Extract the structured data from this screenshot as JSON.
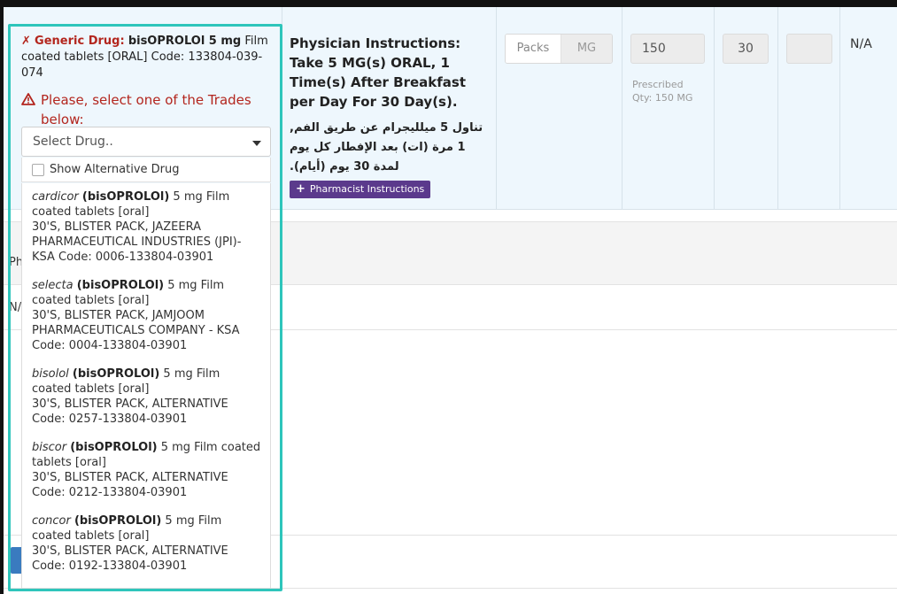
{
  "generic": {
    "x_mark": "✗",
    "label": "Generic Drug:",
    "name": "bisOPROLOl 5 mg",
    "rest": " Film coated tablets [ORAL] Code: 133804-039-074"
  },
  "warning": {
    "text": "Please, select one of the Trades below:",
    "icon": "warning-triangle-icon",
    "color": "#b3261e"
  },
  "select": {
    "placeholder": "Select Drug.."
  },
  "show_alternative": {
    "label": "Show Alternative Drug",
    "checked": false
  },
  "options": [
    {
      "trade": "cardicor",
      "generic": "(bisOPROLOl)",
      "form": " 5 mg Film coated tablets [oral]",
      "details": "30'S, BLISTER PACK, JAZEERA PHARMACEUTICAL INDUSTRIES (JPI)- KSA Code: 0006-133804-03901"
    },
    {
      "trade": "selecta",
      "generic": "(bisOPROLOl)",
      "form": " 5 mg Film coated tablets [oral]",
      "details": "30'S, BLISTER PACK, JAMJOOM PHARMACEUTICALS COMPANY - KSA Code: 0004-133804-03901"
    },
    {
      "trade": "bisolol",
      "generic": "(bisOPROLOl)",
      "form": " 5 mg Film coated tablets [oral]",
      "details": "30'S, BLISTER PACK, ALTERNATIVE Code: 0257-133804-03901"
    },
    {
      "trade": "biscor",
      "generic": "(bisOPROLOl)",
      "form": " 5 mg Film coated tablets [oral]",
      "details": "30'S, BLISTER PACK, ALTERNATIVE Code: 0212-133804-03901"
    },
    {
      "trade": "concor",
      "generic": "(bisOPROLOl)",
      "form": " 5 mg Film coated tablets [oral]",
      "details": "30'S, BLISTER PACK, ALTERNATIVE Code: 0192-133804-03901"
    }
  ],
  "instructions": {
    "english": "Physician Instructions: Take 5 MG(s) ORAL, 1 Time(s) After Breakfast per Day For 30 Day(s).",
    "arabic": "تناول 5 ميلليجرام عن طريق الفم, 1 مرة (ات) بعد الإفطار كل يوم لمدة 30 يوم (أيام)."
  },
  "pharmacist_button": {
    "label": "Pharmacist Instructions",
    "icon": "plus-icon"
  },
  "unit_toggle": {
    "packs": "Packs",
    "mg": "MG"
  },
  "quantity": {
    "value": "150",
    "prescribed_label": "Prescribed",
    "prescribed_qty": "Qty: 150 MG"
  },
  "days": {
    "value": "30"
  },
  "status": "N/A",
  "lower": {
    "section_prefix": "Ph",
    "na": "N/"
  },
  "colors": {
    "highlight": "#2ec5bb",
    "row_bg": "#eef7fd",
    "button": "#5b3a8c"
  }
}
